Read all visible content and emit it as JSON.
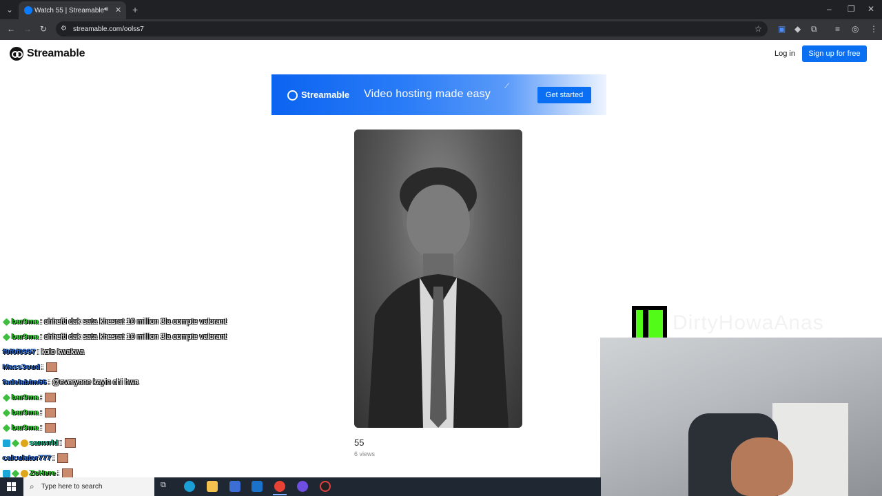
{
  "browser": {
    "tab_title": "Watch 55 | Streamable",
    "tab_audio_icon": "speaker-icon",
    "url": "streamable.com/oolss7"
  },
  "site": {
    "logo_text": "Streamable",
    "login_label": "Log in",
    "signup_label": "Sign up for free"
  },
  "banner": {
    "brand": "Streamable",
    "slogan": "Video hosting made easy",
    "cta": "Get started"
  },
  "video": {
    "title": "55",
    "views": "6 views"
  },
  "chat": [
    {
      "badges": [
        "green"
      ],
      "user": "bar9ma",
      "user_color": "#2fd12f",
      "message": ": chhefti dak sata khesrat 10 million 3la compte valorant",
      "emote": false
    },
    {
      "badges": [
        "green"
      ],
      "user": "bar9ma",
      "user_color": "#2fd12f",
      "message": ": chhefti dak sata khesrat 10 million 3la compte valorant",
      "emote": false
    },
    {
      "badges": [],
      "user": "f0f0f0997",
      "user_color": "#2b6fd6",
      "message": ": kolo kwakwa",
      "emote": false
    },
    {
      "badges": [],
      "user": "Mass3oud",
      "user_color": "#2b6fd6",
      "message": ":",
      "emote": true
    },
    {
      "badges": [],
      "user": "fadelabim66",
      "user_color": "#2b6fd6",
      "message": ": @everyone kayin chi hwa",
      "emote": false
    },
    {
      "badges": [
        "green"
      ],
      "user": "bar9ma",
      "user_color": "#2fd12f",
      "message": ":",
      "emote": true
    },
    {
      "badges": [
        "green"
      ],
      "user": "bar9ma",
      "user_color": "#2fd12f",
      "message": ":",
      "emote": true
    },
    {
      "badges": [
        "green"
      ],
      "user": "bar9ma",
      "user_color": "#2fd12f",
      "message": ":",
      "emote": true
    },
    {
      "badges": [
        "blue",
        "green",
        "gold"
      ],
      "user": "sanwrld",
      "user_color": "#1fbf8f",
      "message": ":",
      "emote": true
    },
    {
      "badges": [],
      "user": "calculator777",
      "user_color": "#2b6fd6",
      "message": ":",
      "emote": true
    },
    {
      "badges": [
        "blue",
        "green",
        "gold"
      ],
      "user": "ZoHere",
      "user_color": "#2fd12f",
      "message": ":",
      "emote": true
    }
  ],
  "overlay": {
    "channel_text": "DirtyHowaAnas",
    "kick_color": "#53fc18"
  },
  "taskbar": {
    "search_placeholder": "Type here to search"
  }
}
